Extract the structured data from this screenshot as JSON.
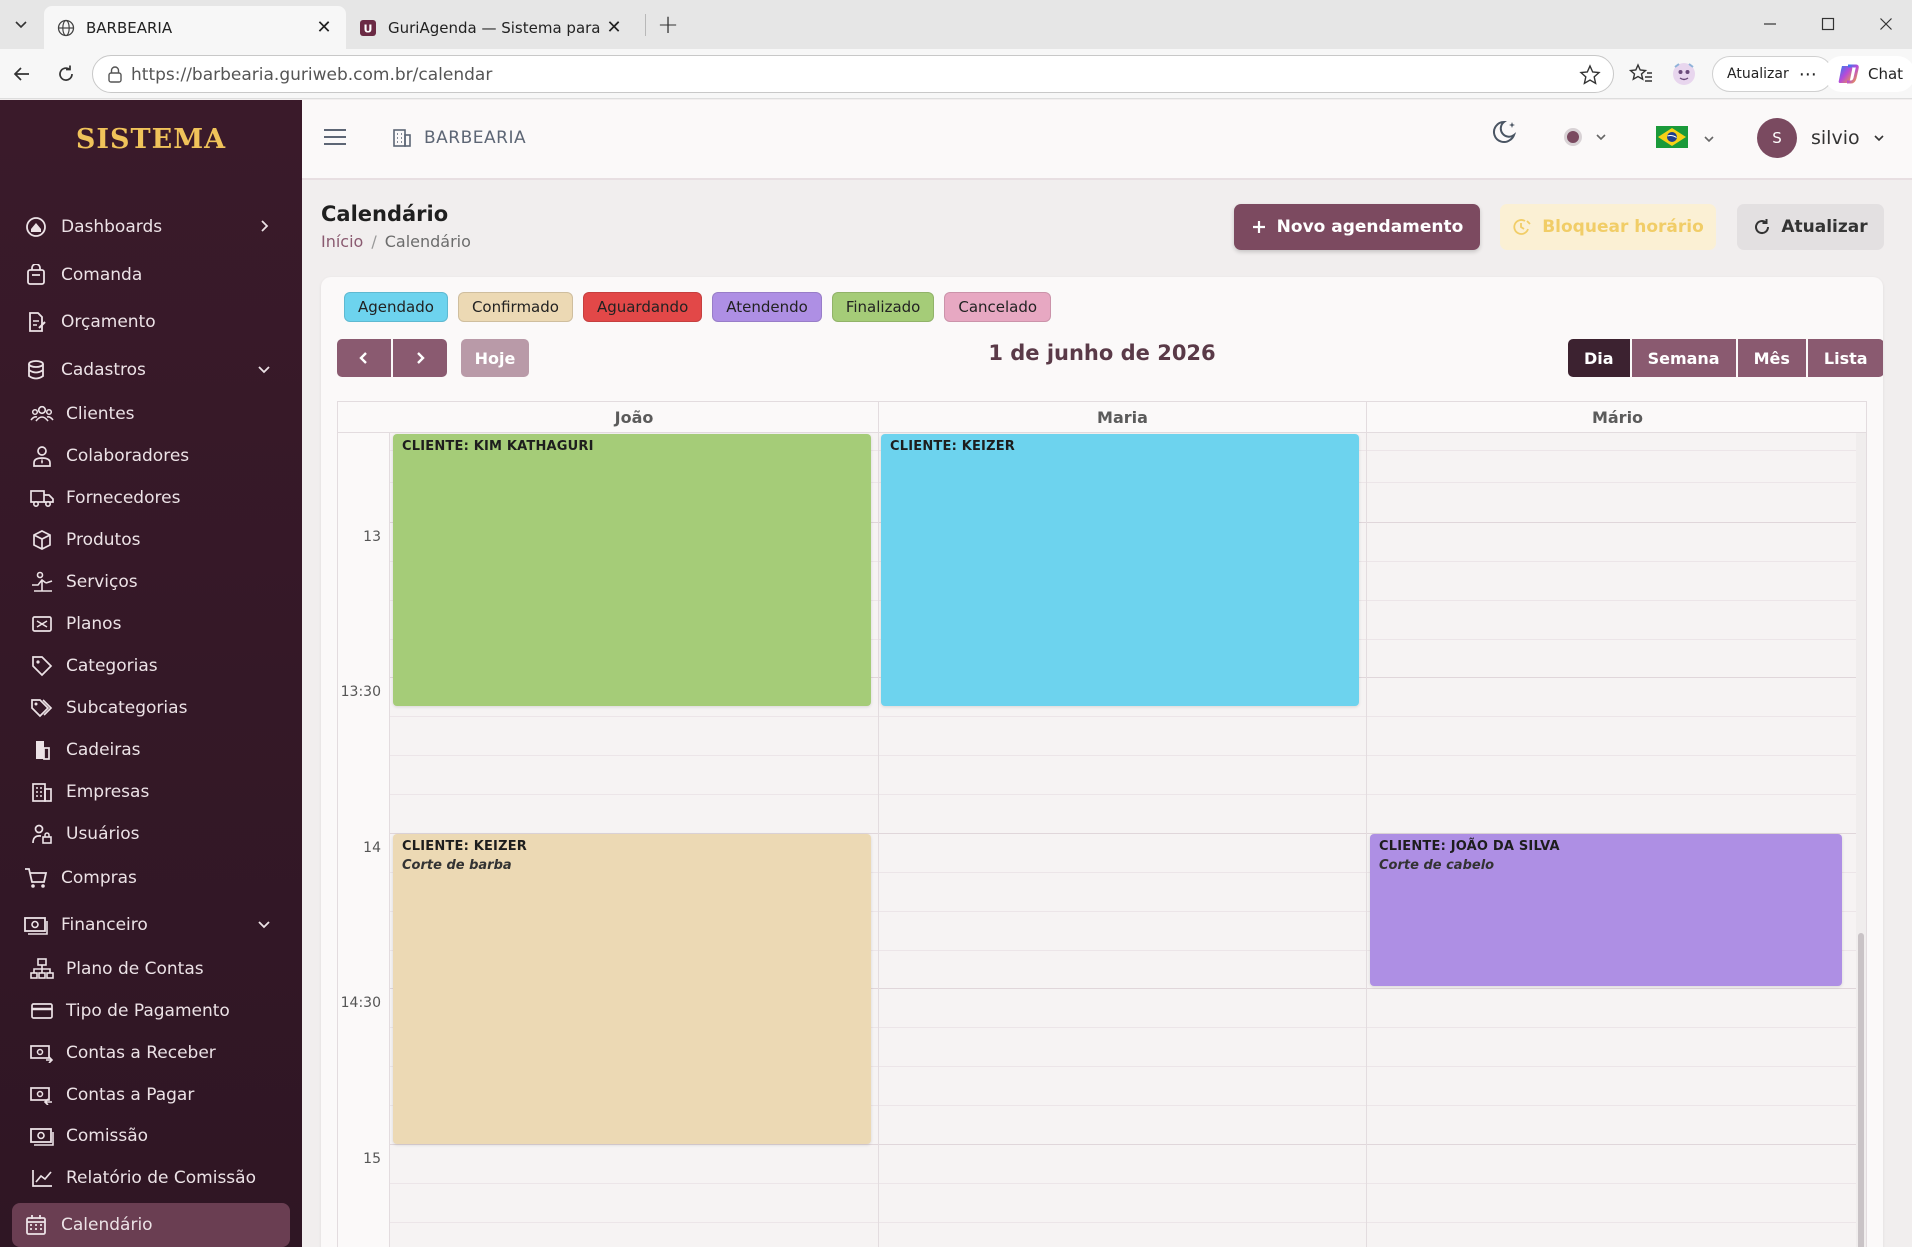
{
  "browser": {
    "tabs": [
      {
        "title": "BARBEARIA",
        "active": true
      },
      {
        "title": "GuriAgenda — Sistema para clínic",
        "active": false
      }
    ],
    "url": "https://barbearia.guriweb.com.br/calendar",
    "update_label": "Atualizar",
    "chat_label": "Chat"
  },
  "sidebar": {
    "brand": "SISTEMA",
    "items": [
      {
        "label": "Dashboards",
        "icon": "dashboard-icon"
      },
      {
        "label": "Comanda",
        "icon": "bag-icon"
      },
      {
        "label": "Orçamento",
        "icon": "document-edit-icon"
      },
      {
        "label": "Cadastros",
        "icon": "database-icon"
      },
      {
        "label": "Clientes",
        "icon": "users-icon"
      },
      {
        "label": "Colaboradores",
        "icon": "user-tie-icon"
      },
      {
        "label": "Fornecedores",
        "icon": "truck-icon"
      },
      {
        "label": "Produtos",
        "icon": "box-icon"
      },
      {
        "label": "Serviços",
        "icon": "service-icon"
      },
      {
        "label": "Planos",
        "icon": "plan-icon"
      },
      {
        "label": "Categorias",
        "icon": "tag-icon"
      },
      {
        "label": "Subcategorias",
        "icon": "tags-icon"
      },
      {
        "label": "Cadeiras",
        "icon": "chair-icon"
      },
      {
        "label": "Empresas",
        "icon": "building-icon"
      },
      {
        "label": "Usuários",
        "icon": "user-lock-icon"
      },
      {
        "label": "Compras",
        "icon": "cart-icon"
      },
      {
        "label": "Financeiro",
        "icon": "money-icon"
      },
      {
        "label": "Plano de Contas",
        "icon": "sitemap-icon"
      },
      {
        "label": "Tipo de Pagamento",
        "icon": "card-icon"
      },
      {
        "label": "Contas a Receber",
        "icon": "receive-icon"
      },
      {
        "label": "Contas a Pagar",
        "icon": "pay-icon"
      },
      {
        "label": "Comissão",
        "icon": "cash-icon"
      },
      {
        "label": "Relatório de Comissão",
        "icon": "chart-line-icon"
      },
      {
        "label": "Calendário",
        "icon": "calendar-icon"
      }
    ]
  },
  "header": {
    "org": "BARBEARIA",
    "avatar_initial": "S",
    "username": "silvio",
    "theme_color": "#7a4a60"
  },
  "page": {
    "title": "Calendário",
    "breadcrumb": [
      "Início",
      "Calendário"
    ],
    "new_button": "Novo agendamento",
    "block_button": "Bloquear horário",
    "refresh_button": "Atualizar"
  },
  "legend": [
    {
      "label": "Agendado",
      "color": "#6dd3ee"
    },
    {
      "label": "Confirmado",
      "color": "#ecd9b4"
    },
    {
      "label": "Aguardando",
      "color": "#e24848"
    },
    {
      "label": "Atendendo",
      "color": "#ae8fe4"
    },
    {
      "label": "Finalizado",
      "color": "#a5cc78"
    },
    {
      "label": "Cancelado",
      "color": "#e7a8c2"
    }
  ],
  "calendar": {
    "prev": "‹",
    "next": "›",
    "today": "Hoje",
    "date_title": "1 de junho de 2026",
    "views": [
      "Dia",
      "Semana",
      "Mês",
      "Lista"
    ],
    "active_view": "Dia",
    "resources": [
      "João",
      "Maria",
      "Mário"
    ],
    "time_labels": [
      "13",
      "13:30",
      "14",
      "14:30",
      "15"
    ],
    "events": [
      {
        "resource": "João",
        "client": "CLIENTE: KIM KATHAGURI",
        "service": "",
        "start": "12:50",
        "end": "13:25",
        "status": "Finalizado",
        "color": "#a5cc78"
      },
      {
        "resource": "Maria",
        "client": "CLIENTE: KEIZER",
        "service": "",
        "start": "12:50",
        "end": "13:25",
        "status": "Agendado",
        "color": "#6dd3ee"
      },
      {
        "resource": "João",
        "client": "CLIENTE: KEIZER",
        "service": "Corte de barba",
        "start": "14:00",
        "end": "15:00",
        "status": "Confirmado",
        "color": "#ecd9b4"
      },
      {
        "resource": "Mário",
        "client": "CLIENTE: JOÃO DA SILVA",
        "service": "Corte de cabelo",
        "start": "14:00",
        "end": "14:30",
        "status": "Atendendo",
        "color": "#ae8fe4"
      }
    ]
  }
}
